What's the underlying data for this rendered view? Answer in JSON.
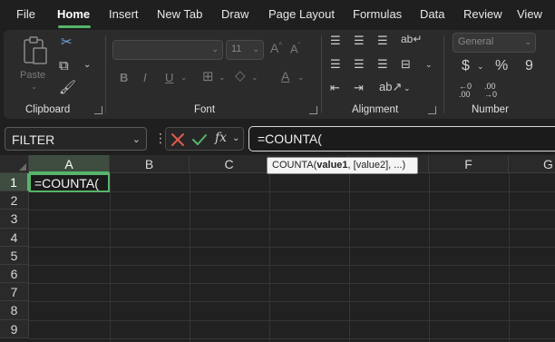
{
  "menu": {
    "tabs": [
      {
        "label": "File"
      },
      {
        "label": "Home"
      },
      {
        "label": "Insert"
      },
      {
        "label": "New Tab"
      },
      {
        "label": "Draw"
      },
      {
        "label": "Page Layout"
      },
      {
        "label": "Formulas"
      },
      {
        "label": "Data"
      },
      {
        "label": "Review"
      },
      {
        "label": "View"
      }
    ],
    "active": "Home"
  },
  "ribbon": {
    "clipboard": {
      "label": "Clipboard",
      "paste_label": "Paste"
    },
    "font": {
      "label": "Font",
      "font_size": "11",
      "bold": "B",
      "italic": "I",
      "underline": "U"
    },
    "alignment": {
      "label": "Alignment"
    },
    "number": {
      "label": "Number",
      "format": "General",
      "currency": "$",
      "percent": "%",
      "comma": "9"
    }
  },
  "formula_bar": {
    "name_box": "FILTER",
    "fx_label": "fx",
    "formula": "=COUNTA("
  },
  "grid": {
    "columns": [
      "A",
      "B",
      "C",
      "D",
      "E",
      "F",
      "G"
    ],
    "rows": [
      "1",
      "2",
      "3",
      "4",
      "5",
      "6",
      "7",
      "8",
      "9"
    ],
    "active_cell": {
      "ref": "A1",
      "value": "=COUNTA("
    }
  },
  "tooltip": {
    "func": "COUNTA(",
    "arg_bold": "value1",
    "rest": ", [value2], ...)"
  },
  "colors": {
    "accent": "#57b46a",
    "background": "#1f1f1f",
    "ribbon": "#2b2b2b",
    "cancel": "#e05a4f",
    "confirm": "#57b46a"
  }
}
